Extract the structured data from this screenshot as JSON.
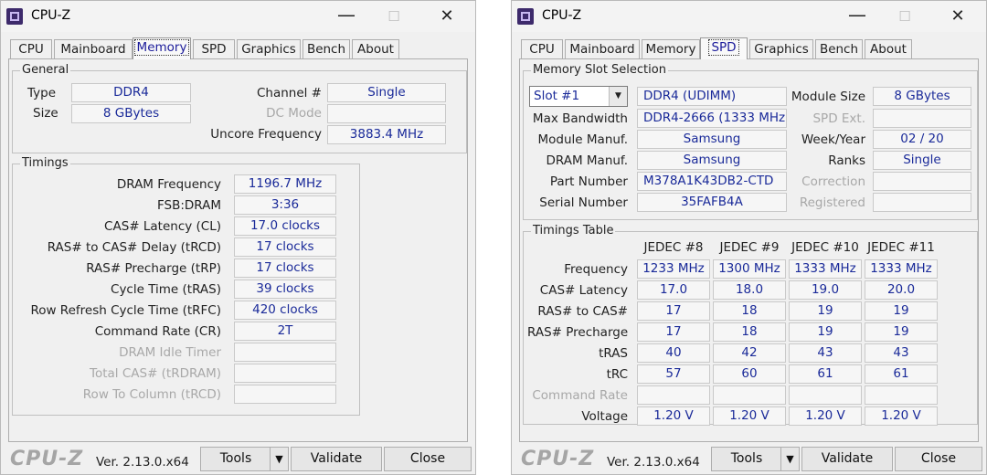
{
  "left_window": {
    "title": "CPU-Z",
    "controls": {
      "minimize": "—",
      "maximize": "☐",
      "close": "✕"
    },
    "tabs": [
      "CPU",
      "Mainboard",
      "Memory",
      "SPD",
      "Graphics",
      "Bench",
      "About"
    ],
    "active_tab": "Memory",
    "general": {
      "title": "General",
      "type_label": "Type",
      "type_value": "DDR4",
      "size_label": "Size",
      "size_value": "8 GBytes",
      "channel_label": "Channel #",
      "channel_value": "Single",
      "dc_mode_label": "DC Mode",
      "dc_mode_value": "",
      "uncore_label": "Uncore Frequency",
      "uncore_value": "3883.4 MHz"
    },
    "timings": {
      "title": "Timings",
      "rows": [
        {
          "label": "DRAM Frequency",
          "value": "1196.7 MHz",
          "enabled": true
        },
        {
          "label": "FSB:DRAM",
          "value": "3:36",
          "enabled": true
        },
        {
          "label": "CAS# Latency (CL)",
          "value": "17.0 clocks",
          "enabled": true
        },
        {
          "label": "RAS# to CAS# Delay (tRCD)",
          "value": "17 clocks",
          "enabled": true
        },
        {
          "label": "RAS# Precharge (tRP)",
          "value": "17 clocks",
          "enabled": true
        },
        {
          "label": "Cycle Time (tRAS)",
          "value": "39 clocks",
          "enabled": true
        },
        {
          "label": "Row Refresh Cycle Time (tRFC)",
          "value": "420 clocks",
          "enabled": true
        },
        {
          "label": "Command Rate (CR)",
          "value": "2T",
          "enabled": true
        },
        {
          "label": "DRAM Idle Timer",
          "value": "",
          "enabled": false
        },
        {
          "label": "Total CAS# (tRDRAM)",
          "value": "",
          "enabled": false
        },
        {
          "label": "Row To Column (tRCD)",
          "value": "",
          "enabled": false
        }
      ]
    },
    "footer": {
      "logo": "CPU-Z",
      "version": "Ver. 2.13.0.x64",
      "tools": "Tools",
      "tools_arrow": "▼",
      "validate": "Validate",
      "close": "Close"
    }
  },
  "right_window": {
    "title": "CPU-Z",
    "controls": {
      "minimize": "—",
      "maximize": "☐",
      "close": "✕"
    },
    "tabs": [
      "CPU",
      "Mainboard",
      "Memory",
      "SPD",
      "Graphics",
      "Bench",
      "About"
    ],
    "active_tab": "SPD",
    "slot": {
      "title": "Memory Slot Selection",
      "selected": "Slot #1",
      "arrow": "▼",
      "type_value": "DDR4 (UDIMM)",
      "module_size_label": "Module Size",
      "module_size_value": "8 GBytes",
      "max_bw_label": "Max Bandwidth",
      "max_bw_value": "DDR4-2666 (1333 MHz)",
      "spd_ext_label": "SPD Ext.",
      "spd_ext_value": "",
      "module_manuf_label": "Module Manuf.",
      "module_manuf_value": "Samsung",
      "week_year_label": "Week/Year",
      "week_year_value": "02 / 20",
      "dram_manuf_label": "DRAM Manuf.",
      "dram_manuf_value": "Samsung",
      "ranks_label": "Ranks",
      "ranks_value": "Single",
      "part_label": "Part Number",
      "part_value": "M378A1K43DB2-CTD",
      "correction_label": "Correction",
      "correction_value": "",
      "serial_label": "Serial Number",
      "serial_value": "35FAFB4A",
      "registered_label": "Registered",
      "registered_value": ""
    },
    "timings_table": {
      "title": "Timings Table",
      "columns": [
        "JEDEC #8",
        "JEDEC #9",
        "JEDEC #10",
        "JEDEC #11"
      ],
      "rows": [
        {
          "label": "Frequency",
          "values": [
            "1233 MHz",
            "1300 MHz",
            "1333 MHz",
            "1333 MHz"
          ],
          "enabled": true
        },
        {
          "label": "CAS# Latency",
          "values": [
            "17.0",
            "18.0",
            "19.0",
            "20.0"
          ],
          "enabled": true
        },
        {
          "label": "RAS# to CAS#",
          "values": [
            "17",
            "18",
            "19",
            "19"
          ],
          "enabled": true
        },
        {
          "label": "RAS# Precharge",
          "values": [
            "17",
            "18",
            "19",
            "19"
          ],
          "enabled": true
        },
        {
          "label": "tRAS",
          "values": [
            "40",
            "42",
            "43",
            "43"
          ],
          "enabled": true
        },
        {
          "label": "tRC",
          "values": [
            "57",
            "60",
            "61",
            "61"
          ],
          "enabled": true
        },
        {
          "label": "Command Rate",
          "values": [
            "",
            "",
            "",
            ""
          ],
          "enabled": false
        },
        {
          "label": "Voltage",
          "values": [
            "1.20 V",
            "1.20 V",
            "1.20 V",
            "1.20 V"
          ],
          "enabled": true
        }
      ]
    },
    "footer": {
      "logo": "CPU-Z",
      "version": "Ver. 2.13.0.x64",
      "tools": "Tools",
      "tools_arrow": "▼",
      "validate": "Validate",
      "close": "Close"
    }
  }
}
